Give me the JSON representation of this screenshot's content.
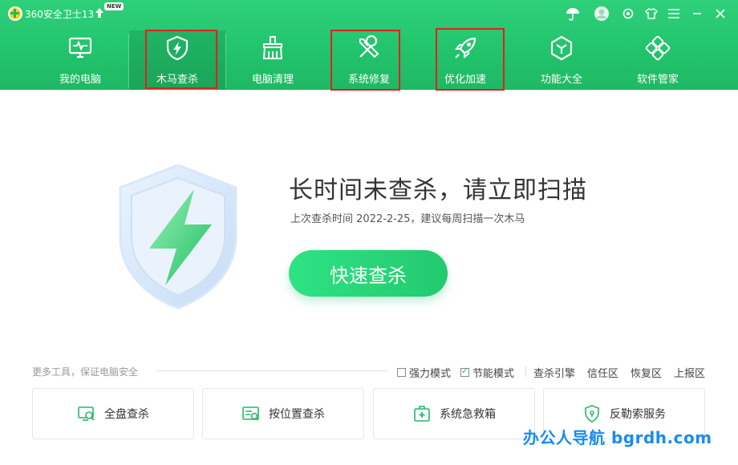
{
  "app": {
    "title": "360安全卫士13",
    "new_badge": "NEW"
  },
  "nav": {
    "items": [
      {
        "label": "我的电脑",
        "icon": "monitor-icon"
      },
      {
        "label": "木马查杀",
        "icon": "shield-bolt-icon",
        "active": true
      },
      {
        "label": "电脑清理",
        "icon": "broom-icon"
      },
      {
        "label": "系统修复",
        "icon": "wrench-screwdriver-icon"
      },
      {
        "label": "优化加速",
        "icon": "rocket-icon"
      },
      {
        "label": "功能大全",
        "icon": "cube-icon"
      },
      {
        "label": "软件管家",
        "icon": "apps-icon"
      }
    ]
  },
  "main": {
    "headline": "长时间未查杀，请立即扫描",
    "subline": "上次查杀时间 2022-2-25，建议每周扫描一次木马",
    "scan_button": "快速查杀"
  },
  "tools": {
    "more_label": "更多工具，保证电脑安全",
    "options": [
      {
        "label": "强力模式",
        "checked": false
      },
      {
        "label": "节能模式",
        "checked": true
      }
    ],
    "links": [
      "查杀引擎",
      "信任区",
      "恢复区",
      "上报区"
    ],
    "cards": [
      {
        "label": "全盘查杀",
        "icon": "disk-scan-icon"
      },
      {
        "label": "按位置查杀",
        "icon": "location-scan-icon"
      },
      {
        "label": "系统急救箱",
        "icon": "first-aid-kit-icon"
      },
      {
        "label": "反勒索服务",
        "icon": "shield-lock-icon"
      }
    ]
  },
  "watermark": "办公人导航 bgrdh.com",
  "colors": {
    "brand_green": "#22c46c",
    "highlight_red": "#e02020",
    "watermark_blue": "#1a8cf0"
  }
}
